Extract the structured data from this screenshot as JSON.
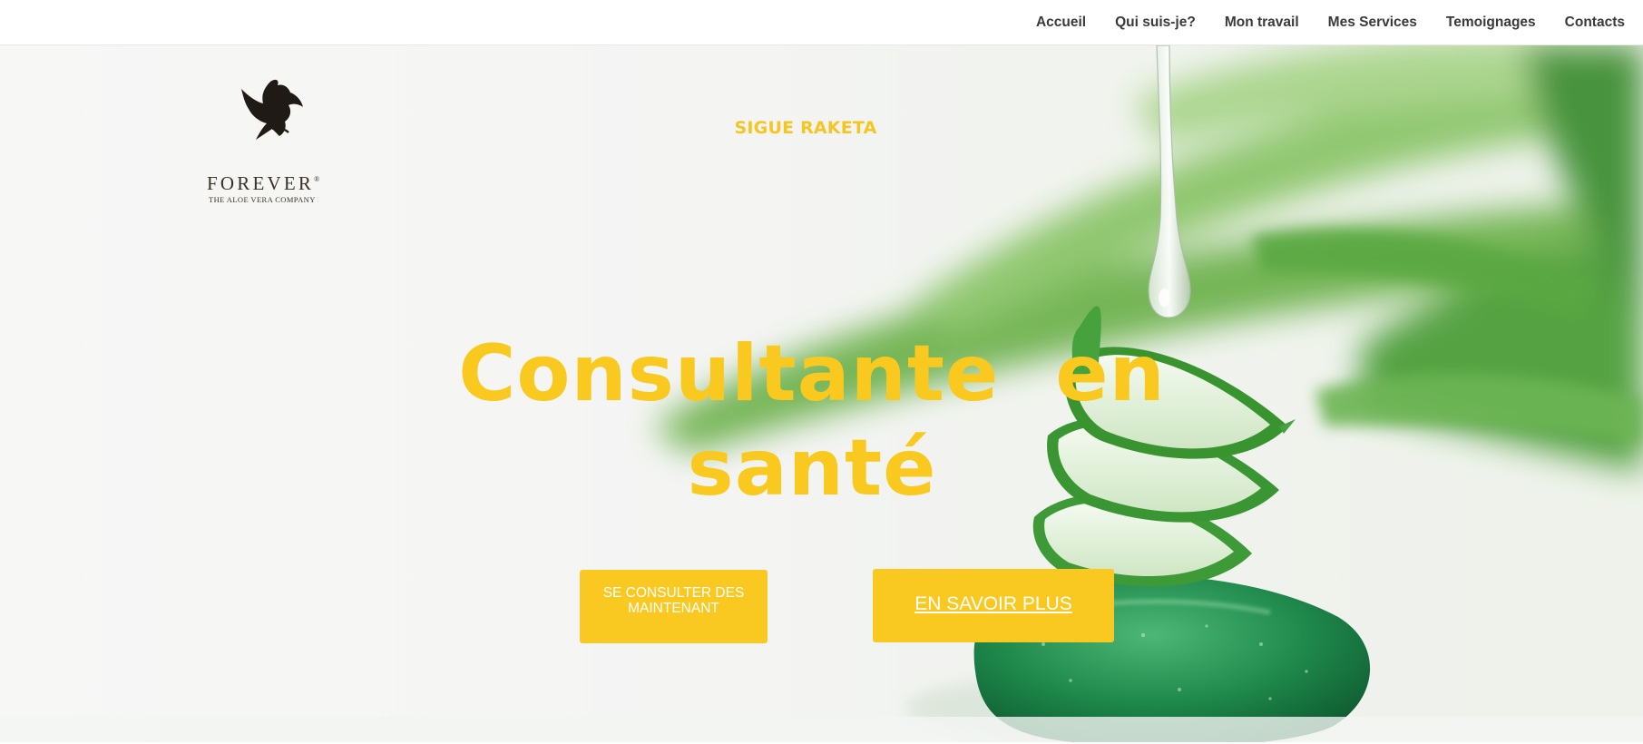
{
  "nav": {
    "items": [
      {
        "label": "Accueil"
      },
      {
        "label": "Qui suis-je?"
      },
      {
        "label": "Mon travail"
      },
      {
        "label": "Mes Services"
      },
      {
        "label": "Temoignages"
      },
      {
        "label": "Contacts"
      }
    ]
  },
  "logo": {
    "word": "FOREVER",
    "reg": "®",
    "tagline": "THE ALOE VERA COMPANY",
    "icon": "eagle-icon"
  },
  "hero": {
    "brand_name": "SIGUE RAKETA",
    "headline_line1": "Consultante  en",
    "headline_line2": "santé",
    "primary_button": "SE CONSULTER DES MAINTENANT",
    "secondary_button": "EN SAVOIR PLUS",
    "background_image": "aloe-vera-slices-on-green-stone-with-gel-drop"
  },
  "colors": {
    "accent": "#f9c91f",
    "nav_text": "#3a3a3a",
    "aloe_green": "#3f9a3a",
    "stone_green": "#1f8a4c"
  }
}
